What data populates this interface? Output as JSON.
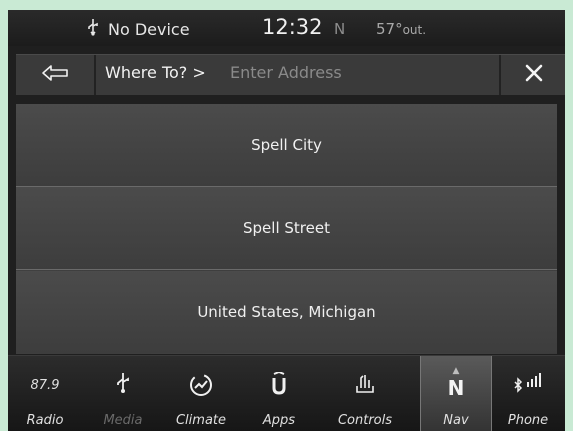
{
  "status": {
    "device": "No Device",
    "time": "12:32",
    "compass": "N",
    "temperature": "57°",
    "temperature_suffix": "out."
  },
  "search": {
    "prefix": "Where To? >",
    "placeholder": "Enter Address"
  },
  "results": [
    {
      "label": "Spell City"
    },
    {
      "label": "Spell Street"
    },
    {
      "label": "United States, Michigan"
    }
  ],
  "nav": {
    "radio": {
      "label": "Radio",
      "freq": "87.9"
    },
    "media": {
      "label": "Media"
    },
    "climate": {
      "label": "Climate"
    },
    "apps": {
      "label": "Apps"
    },
    "controls": {
      "label": "Controls"
    },
    "nav": {
      "label": "Nav",
      "icon_text": "N"
    },
    "phone": {
      "label": "Phone"
    }
  },
  "icons": {
    "usb": "usb-icon",
    "back": "back-arrow-icon",
    "close": "close-icon",
    "climate": "climate-icon",
    "apps": "apps-icon",
    "controls": "controls-icon",
    "compass": "compass-icon",
    "bluetooth": "bluetooth-icon",
    "signal": "signal-bars-icon"
  }
}
